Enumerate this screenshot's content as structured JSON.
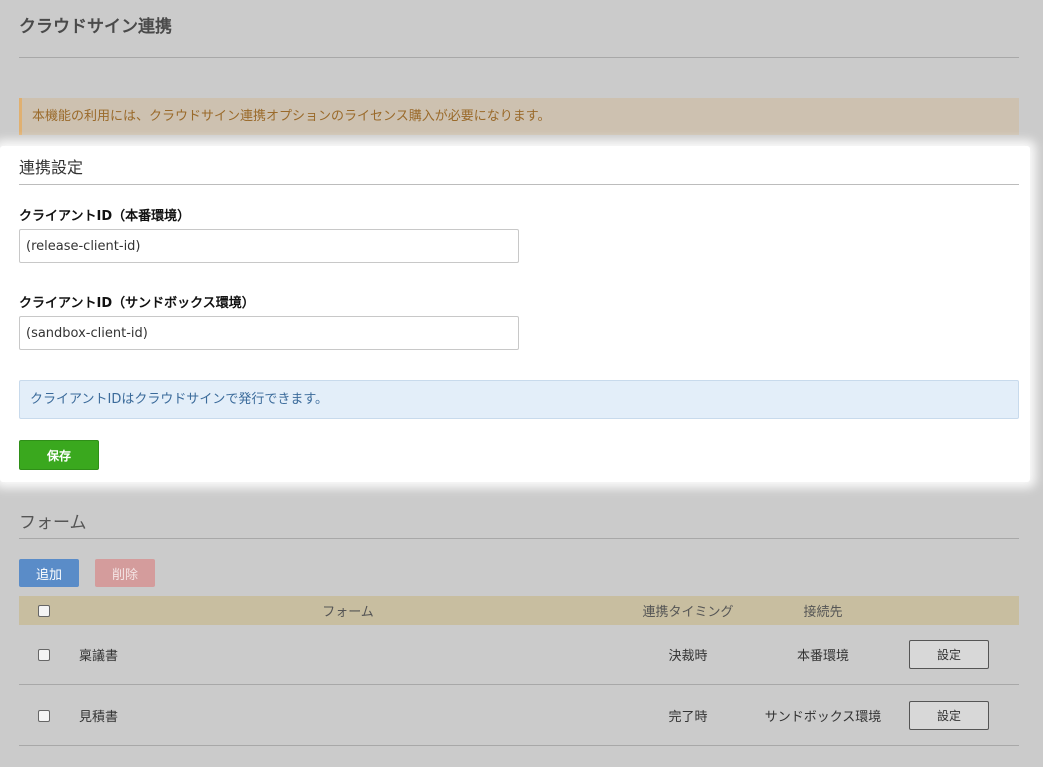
{
  "page": {
    "title": "クラウドサイン連携",
    "license_notice": "本機能の利用には、クラウドサイン連携オプションのライセンス購入が必要になります。"
  },
  "settings_section": {
    "heading": "連携設定",
    "release_label": "クライアントID（本番環境）",
    "release_value": "(release-client-id)",
    "sandbox_label": "クライアントID（サンドボックス環境）",
    "sandbox_value": "(sandbox-client-id)",
    "info": "クライアントIDはクラウドサインで発行できます。",
    "save_label": "保存"
  },
  "forms_section": {
    "heading": "フォーム",
    "add_label": "追加",
    "delete_label": "削除",
    "columns": {
      "form": "フォーム",
      "timing": "連携タイミング",
      "target": "接続先"
    },
    "rows": [
      {
        "name": "稟議書",
        "timing": "決裁時",
        "target": "本番環境",
        "action": "設定"
      },
      {
        "name": "見積書",
        "timing": "完了時",
        "target": "サンドボックス環境",
        "action": "設定"
      }
    ]
  }
}
